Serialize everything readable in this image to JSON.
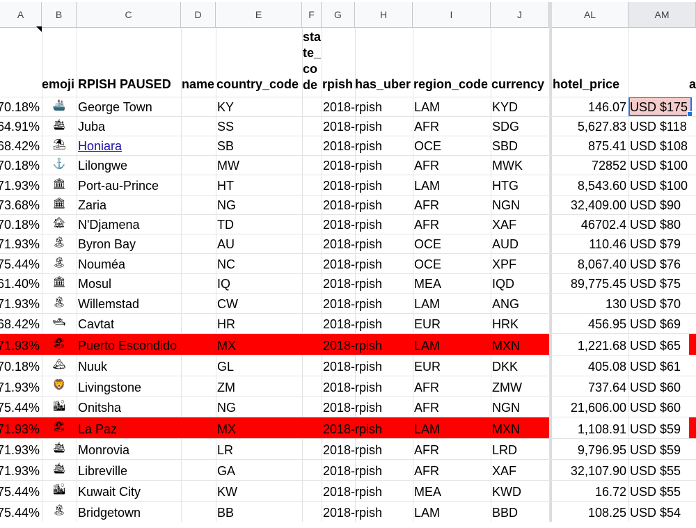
{
  "columns": {
    "A": "A",
    "B": "B",
    "C": "C",
    "D": "D",
    "E": "E",
    "F": "F",
    "G": "G",
    "H": "H",
    "I": "I",
    "J": "J",
    "AL": "AL",
    "AM": "AM"
  },
  "headers": {
    "B": "emoji",
    "C": "RPISH PAUSED",
    "D": "name",
    "E": "country_code",
    "F": "state_code",
    "F_lines": [
      "sta",
      "te_",
      "co",
      "de"
    ],
    "G": "rpish",
    "H": "has_uber",
    "I": "region_code",
    "J": "currency",
    "AL": "hotel_price",
    "AM_partial": "a"
  },
  "rows": [
    {
      "pct": "70.18%",
      "emoji": "🚢",
      "city": "George Town",
      "cc": "KY",
      "rpish": "2018-rpish",
      "region": "LAM",
      "currency": "KYD",
      "hotel": "146.07",
      "usd": "USD $175",
      "link": false,
      "red": false
    },
    {
      "pct": "64.91%",
      "emoji": "🛳",
      "city": "Juba",
      "cc": "SS",
      "rpish": "2018-rpish",
      "region": "AFR",
      "currency": "SDG",
      "hotel": "5,627.83",
      "usd": "USD $118",
      "link": false,
      "red": false
    },
    {
      "pct": "68.42%",
      "emoji": "⛱",
      "city": "Honiara",
      "cc": "SB",
      "rpish": "2018-rpish",
      "region": "OCE",
      "currency": "SBD",
      "hotel": "875.41",
      "usd": "USD $108",
      "link": true,
      "red": false
    },
    {
      "pct": "70.18%",
      "emoji": "⚓",
      "city": "Lilongwe",
      "cc": "MW",
      "rpish": "2018-rpish",
      "region": "AFR",
      "currency": "MWK",
      "hotel": "72852",
      "usd": "USD $100",
      "link": false,
      "red": false
    },
    {
      "pct": "71.93%",
      "emoji": "🏛",
      "city": "Port-au-Prince",
      "cc": "HT",
      "rpish": "2018-rpish",
      "region": "LAM",
      "currency": "HTG",
      "hotel": "8,543.60",
      "usd": "USD $100",
      "link": false,
      "red": false
    },
    {
      "pct": "73.68%",
      "emoji": "🏛",
      "city": "Zaria",
      "cc": "NG",
      "rpish": "2018-rpish",
      "region": "AFR",
      "currency": "NGN",
      "hotel": "32,409.00",
      "usd": "USD $90",
      "link": false,
      "red": false
    },
    {
      "pct": "70.18%",
      "emoji": "🏚",
      "city": "N'Djamena",
      "cc": "TD",
      "rpish": "2018-rpish",
      "region": "AFR",
      "currency": "XAF",
      "hotel": "46702.4",
      "usd": "USD $80",
      "link": false,
      "red": false
    },
    {
      "pct": "71.93%",
      "emoji": "🏝",
      "city": "Byron Bay",
      "cc": "AU",
      "rpish": "2018-rpish",
      "region": "OCE",
      "currency": "AUD",
      "hotel": "110.46",
      "usd": "USD $79",
      "link": false,
      "red": false
    },
    {
      "pct": "75.44%",
      "emoji": "🏝",
      "city": "Nouméa",
      "cc": "NC",
      "rpish": "2018-rpish",
      "region": "OCE",
      "currency": "XPF",
      "hotel": "8,067.40",
      "usd": "USD $76",
      "link": false,
      "red": false
    },
    {
      "pct": "61.40%",
      "emoji": "🏛",
      "city": "Mosul",
      "cc": "IQ",
      "rpish": "2018-rpish",
      "region": "MEA",
      "currency": "IQD",
      "hotel": "89,775.45",
      "usd": "USD $75",
      "link": false,
      "red": false
    },
    {
      "pct": "71.93%",
      "emoji": "🏝",
      "city": "Willemstad",
      "cc": "CW",
      "rpish": "2018-rpish",
      "region": "LAM",
      "currency": "ANG",
      "hotel": "130",
      "usd": "USD $70",
      "link": false,
      "red": false
    },
    {
      "pct": "68.42%",
      "emoji": "🛥",
      "city": "Cavtat",
      "cc": "HR",
      "rpish": "2018-rpish",
      "region": "EUR",
      "currency": "HRK",
      "hotel": "456.95",
      "usd": "USD $69",
      "link": false,
      "red": false
    },
    {
      "pct": "71.93%",
      "emoji": "🏖",
      "city": "Puerto Escondido",
      "cc": "MX",
      "rpish": "2018-rpish",
      "region": "LAM",
      "currency": "MXN",
      "hotel": "1,221.68",
      "usd": "USD $65",
      "link": false,
      "red": true
    },
    {
      "pct": "70.18%",
      "emoji": "🏔",
      "city": "Nuuk",
      "cc": "GL",
      "rpish": "2018-rpish",
      "region": "EUR",
      "currency": "DKK",
      "hotel": "405.08",
      "usd": "USD $61",
      "link": false,
      "red": false
    },
    {
      "pct": "71.93%",
      "emoji": "🦁",
      "city": "Livingstone",
      "cc": "ZM",
      "rpish": "2018-rpish",
      "region": "AFR",
      "currency": "ZMW",
      "hotel": "737.64",
      "usd": "USD $60",
      "link": false,
      "red": false
    },
    {
      "pct": "75.44%",
      "emoji": "🏙",
      "city": "Onitsha",
      "cc": "NG",
      "rpish": "2018-rpish",
      "region": "AFR",
      "currency": "NGN",
      "hotel": "21,606.00",
      "usd": "USD $60",
      "link": false,
      "red": false
    },
    {
      "pct": "71.93%",
      "emoji": "🏖",
      "city": "La Paz",
      "cc": "MX",
      "rpish": "2018-rpish",
      "region": "LAM",
      "currency": "MXN",
      "hotel": "1,108.91",
      "usd": "USD $59",
      "link": false,
      "red": true
    },
    {
      "pct": "71.93%",
      "emoji": "🛳",
      "city": "Monrovia",
      "cc": "LR",
      "rpish": "2018-rpish",
      "region": "AFR",
      "currency": "LRD",
      "hotel": "9,796.95",
      "usd": "USD $59",
      "link": false,
      "red": false
    },
    {
      "pct": "71.93%",
      "emoji": "🛳",
      "city": "Libreville",
      "cc": "GA",
      "rpish": "2018-rpish",
      "region": "AFR",
      "currency": "XAF",
      "hotel": "32,107.90",
      "usd": "USD $55",
      "link": false,
      "red": false
    },
    {
      "pct": "75.44%",
      "emoji": "🏙",
      "city": "Kuwait City",
      "cc": "KW",
      "rpish": "2018-rpish",
      "region": "MEA",
      "currency": "KWD",
      "hotel": "16.72",
      "usd": "USD $55",
      "link": false,
      "red": false
    },
    {
      "pct": "75.44%",
      "emoji": "🏝",
      "city": "Bridgetown",
      "cc": "BB",
      "rpish": "2018-rpish",
      "region": "LAM",
      "currency": "BBD",
      "hotel": "108.25",
      "usd": "USD $54",
      "link": false,
      "red": false
    }
  ],
  "colors": {
    "highlight_red": "#ff0000",
    "selected_cell_fill": "#f4cccc",
    "selection_blue": "#1a73e8",
    "link_blue": "#1a0dab"
  }
}
